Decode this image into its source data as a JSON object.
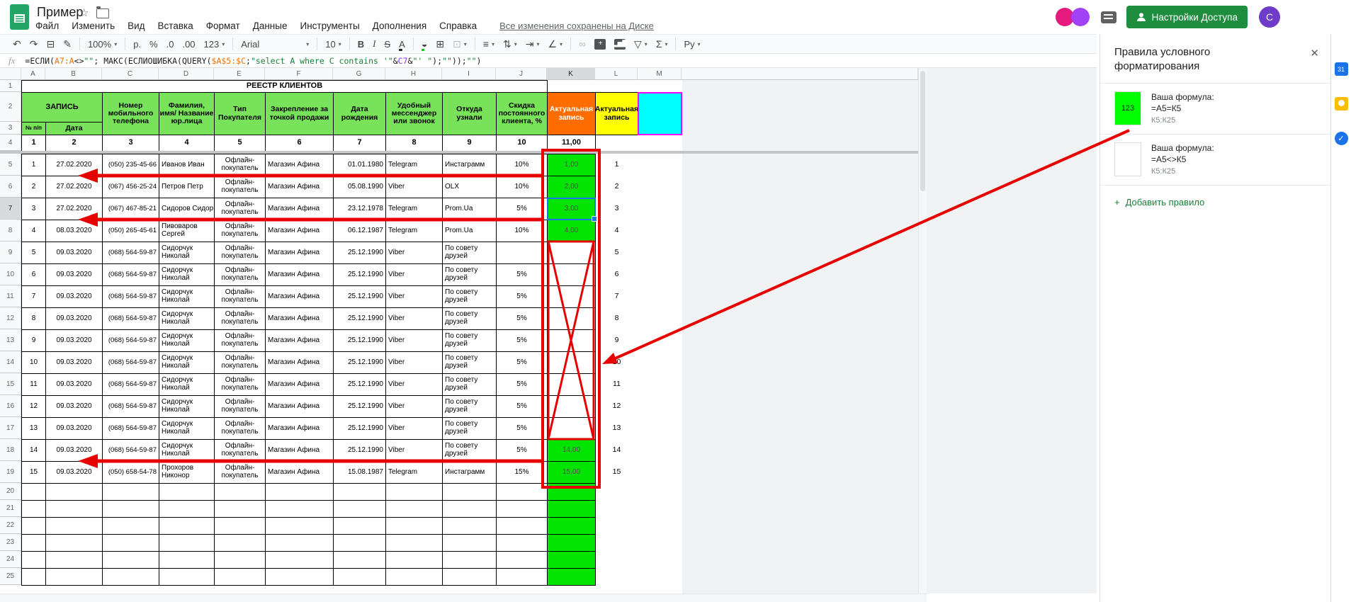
{
  "app": {
    "title": "Пример",
    "star": "☆",
    "menu_items": [
      "Файл",
      "Изменить",
      "Вид",
      "Вставка",
      "Формат",
      "Данные",
      "Инструменты",
      "Дополнения",
      "Справка"
    ],
    "saved_status": "Все изменения сохранены на Диске",
    "share_button": "Настройки Доступа",
    "account_initial": "C",
    "avatar_colors": [
      "#e5197e",
      "#a142f4"
    ]
  },
  "toolbar": {
    "items": [
      {
        "name": "undo",
        "glyph": "↶"
      },
      {
        "name": "redo",
        "glyph": "↷"
      },
      {
        "name": "print",
        "glyph": "⊟"
      },
      {
        "name": "paint-format",
        "glyph": "✎"
      },
      {
        "name": "sep"
      },
      {
        "name": "zoom",
        "label": "100%",
        "dropdown": true
      },
      {
        "name": "sep"
      },
      {
        "name": "format-currency",
        "label": "р."
      },
      {
        "name": "format-percent",
        "label": "%"
      },
      {
        "name": "decrease-decimal",
        "label": ".0"
      },
      {
        "name": "increase-decimal",
        "label": ".00"
      },
      {
        "name": "number-format",
        "label": "123",
        "dropdown": true
      },
      {
        "name": "sep"
      },
      {
        "name": "font-family",
        "label": "Arial",
        "dropdown": true,
        "wide": true
      },
      {
        "name": "sep"
      },
      {
        "name": "font-size",
        "label": "10",
        "dropdown": true
      },
      {
        "name": "sep"
      },
      {
        "name": "bold",
        "label": "B",
        "style": "b"
      },
      {
        "name": "italic",
        "label": "I",
        "style": "i"
      },
      {
        "name": "strikethrough",
        "label": "S",
        "style": "s"
      },
      {
        "name": "text-color",
        "label": "A",
        "bar": "#202124"
      },
      {
        "name": "sep"
      },
      {
        "name": "fill-color",
        "glyph": "◒",
        "bar": "#00c800"
      },
      {
        "name": "borders",
        "glyph": "⊞"
      },
      {
        "name": "merge-cells",
        "glyph": "⊡",
        "dropdown": true,
        "disabled": true
      },
      {
        "name": "sep"
      },
      {
        "name": "horizontal-align",
        "glyph": "≡",
        "dropdown": true
      },
      {
        "name": "vertical-align",
        "glyph": "⇅",
        "dropdown": true
      },
      {
        "name": "text-wrap",
        "glyph": "⇥",
        "dropdown": true
      },
      {
        "name": "text-rotation",
        "glyph": "∠",
        "dropdown": true
      },
      {
        "name": "sep"
      },
      {
        "name": "insert-link",
        "glyph": "∞",
        "disabled": true
      },
      {
        "name": "insert-comment",
        "glyph": "+",
        "boxed": true
      },
      {
        "name": "insert-chart",
        "glyph": "▂▅▇",
        "boxed": true
      },
      {
        "name": "filter",
        "glyph": "▽",
        "dropdown": true
      },
      {
        "name": "functions",
        "glyph": "Σ",
        "dropdown": true
      },
      {
        "name": "sep"
      },
      {
        "name": "input-tools",
        "label": "Ру",
        "dropdown": true
      }
    ],
    "collapse": "∧"
  },
  "formula_bar": {
    "fx": "fx",
    "tokens": [
      {
        "t": "=ЕСЛИ(",
        "c": "k"
      },
      {
        "t": "A7:A",
        "c": "o"
      },
      {
        "t": "<>",
        "c": "k"
      },
      {
        "t": "\"\"",
        "c": "g"
      },
      {
        "t": "; МАКС(ЕСЛИОШИБКА(QUERY(",
        "c": "k"
      },
      {
        "t": "$A$5:$C",
        "c": "o"
      },
      {
        "t": ";",
        "c": "k"
      },
      {
        "t": "\"select A where C contains '\"",
        "c": "g"
      },
      {
        "t": "&",
        "c": "k"
      },
      {
        "t": "C7",
        "c": "p"
      },
      {
        "t": "&",
        "c": "k"
      },
      {
        "t": "\"' \"",
        "c": "g"
      },
      {
        "t": ");",
        "c": "k"
      },
      {
        "t": "\"\"",
        "c": "g"
      },
      {
        "t": "));",
        "c": "k"
      },
      {
        "t": "\"\"",
        "c": "g"
      },
      {
        "t": ")",
        "c": "k"
      }
    ]
  },
  "sheet": {
    "column_letters": [
      "A",
      "B",
      "C",
      "D",
      "E",
      "F",
      "G",
      "H",
      "I",
      "J",
      "K",
      "L",
      "M"
    ],
    "row_numbers": [
      "1",
      "2",
      "3",
      "4",
      "5",
      "6",
      "7",
      "8",
      "9",
      "10",
      "11",
      "12",
      "13",
      "14",
      "15",
      "16",
      "17",
      "18",
      "19",
      "20",
      "21",
      "22",
      "23",
      "24",
      "25"
    ],
    "title": "РЕЕСТР КЛИЕНТОВ",
    "header": {
      "record_group": "ЗАПИСЬ",
      "num": "№ п/п",
      "date": "Дата",
      "phone": "Номер мобильного телефона",
      "name": "Фамилия, имя/ Название юр.лица",
      "buyer_type": "Тип Покупателя",
      "sales_point": "Закрепление за точкой продажи",
      "birth_date": "Дата рождения",
      "messenger": "Удобный мессенджер или звонок",
      "source": "Откуда узнали",
      "discount": "Скидка постоянного клиента, %",
      "actual_record_k": "Актуальная запись",
      "actual_record_l": "Актуальная запись"
    },
    "numbering_row": [
      "1",
      "2",
      "3",
      "4",
      "5",
      "6",
      "7",
      "8",
      "9",
      "10",
      "11,00"
    ],
    "rows": [
      {
        "cells": [
          "1",
          "27.02.2020",
          "(050) 235-45-66",
          "Иванов Иван",
          "Офлайн-покупатель",
          "Магазин Афина",
          "01.01.1980",
          "Telegram",
          "Инстаграмм",
          "10%",
          "1,00"
        ],
        "k_green": true,
        "l": "1"
      },
      {
        "cells": [
          "2",
          "27.02.2020",
          "(067) 456-25-24",
          "Петров Петр",
          "Офлайн-покупатель",
          "Магазин Афина",
          "05.08.1990",
          "Viber",
          "OLX",
          "10%",
          "2,00"
        ],
        "k_green": true,
        "l": "2"
      },
      {
        "cells": [
          "3",
          "27.02.2020",
          "(067) 467-85-21",
          "Сидоров Сидор",
          "Офлайн-покупатель",
          "Магазин Афина",
          "23.12.1978",
          "Telegram",
          "Prom.Ua",
          "5%",
          "3,00"
        ],
        "k_green": true,
        "selected": true,
        "l": "3"
      },
      {
        "cells": [
          "4",
          "08.03.2020",
          "(050) 265-45-61",
          "Пивоваров Сергей",
          "Офлайн-покупатель",
          "Магазин Афина",
          "06.12.1987",
          "Telegram",
          "Prom.Ua",
          "10%",
          "4,00"
        ],
        "k_green": true,
        "l": "4"
      },
      {
        "cells": [
          "5",
          "09.03.2020",
          "(068) 564-59-87",
          "Сидорчук Николай",
          "Офлайн-покупатель",
          "Магазин Афина",
          "25.12.1990",
          "Viber",
          "По совету друзей",
          "",
          ""
        ],
        "k_green": false,
        "l": "5"
      },
      {
        "cells": [
          "6",
          "09.03.2020",
          "(068) 564-59-87",
          "Сидорчук Николай",
          "Офлайн-покупатель",
          "Магазин Афина",
          "25.12.1990",
          "Viber",
          "По совету друзей",
          "5%",
          ""
        ],
        "k_green": false,
        "l": "6"
      },
      {
        "cells": [
          "7",
          "09.03.2020",
          "(068) 564-59-87",
          "Сидорчук Николай",
          "Офлайн-покупатель",
          "Магазин Афина",
          "25.12.1990",
          "Viber",
          "По совету друзей",
          "5%",
          ""
        ],
        "k_green": false,
        "l": "7"
      },
      {
        "cells": [
          "8",
          "09.03.2020",
          "(068) 564-59-87",
          "Сидорчук Николай",
          "Офлайн-покупатель",
          "Магазин Афина",
          "25.12.1990",
          "Viber",
          "По совету друзей",
          "5%",
          ""
        ],
        "k_green": false,
        "l": "8"
      },
      {
        "cells": [
          "9",
          "09.03.2020",
          "(068) 564-59-87",
          "Сидорчук Николай",
          "Офлайн-покупатель",
          "Магазин Афина",
          "25.12.1990",
          "Viber",
          "По совету друзей",
          "5%",
          ""
        ],
        "k_green": false,
        "l": "9"
      },
      {
        "cells": [
          "10",
          "09.03.2020",
          "(068) 564-59-87",
          "Сидорчук Николай",
          "Офлайн-покупатель",
          "Магазин Афина",
          "25.12.1990",
          "Viber",
          "По совету друзей",
          "5%",
          ""
        ],
        "k_green": false,
        "l": "10"
      },
      {
        "cells": [
          "11",
          "09.03.2020",
          "(068) 564-59-87",
          "Сидорчук Николай",
          "Офлайн-покупатель",
          "Магазин Афина",
          "25.12.1990",
          "Viber",
          "По совету друзей",
          "5%",
          ""
        ],
        "k_green": false,
        "l": "11"
      },
      {
        "cells": [
          "12",
          "09.03.2020",
          "(068) 564-59-87",
          "Сидорчук Николай",
          "Офлайн-покупатель",
          "Магазин Афина",
          "25.12.1990",
          "Viber",
          "По совету друзей",
          "5%",
          ""
        ],
        "k_green": false,
        "l": "12"
      },
      {
        "cells": [
          "13",
          "09.03.2020",
          "(068) 564-59-87",
          "Сидорчук Николай",
          "Офлайн-покупатель",
          "Магазин Афина",
          "25.12.1990",
          "Viber",
          "По совету друзей",
          "5%",
          ""
        ],
        "k_green": false,
        "l": "13"
      },
      {
        "cells": [
          "14",
          "09.03.2020",
          "(068) 564-59-87",
          "Сидорчук Николай",
          "Офлайн-покупатель",
          "Магазин Афина",
          "25.12.1990",
          "Viber",
          "По совету друзей",
          "5%",
          "14,00"
        ],
        "k_green": true,
        "l": "14"
      },
      {
        "cells": [
          "15",
          "09.03.2020",
          "(050) 658-54-78",
          "Прохоров Никонор",
          "Офлайн-покупатель",
          "Магазин Афина",
          "15.08.1987",
          "Telegram",
          "Инстаграмм",
          "15%",
          "15,00"
        ],
        "k_green": true,
        "l": "15"
      }
    ],
    "empty_rows": 6
  },
  "panel": {
    "title": "Правила условного форматирования",
    "close": "✕",
    "rules": [
      {
        "swatch_color": "#00ff00",
        "swatch_label": "123",
        "label": "Ваша формула:",
        "formula": "=А5=К5",
        "range": "К5:К25"
      },
      {
        "swatch_color": "#ffffff",
        "swatch_label": "",
        "label": "Ваша формула:",
        "formula": "=А5<>К5",
        "range": "К5:К25"
      }
    ],
    "plus": "+",
    "add_rule": "Добавить правило"
  },
  "side_icons": [
    {
      "name": "calendar",
      "label": "31"
    },
    {
      "name": "keep",
      "label": ""
    },
    {
      "name": "tasks",
      "label": "✓"
    }
  ],
  "colors": {
    "header_green": "#78e25b",
    "k_cell_green": "#00e400",
    "k_header_orange": "#ff6d01",
    "l_header_yellow": "#ffff00",
    "m_cell_cyan": "#00ffff",
    "m_border_magenta": "#ff00ff",
    "annotation_red": "#e60000",
    "selection_blue": "#1a73e8",
    "share_green": "#1e8e3e"
  }
}
